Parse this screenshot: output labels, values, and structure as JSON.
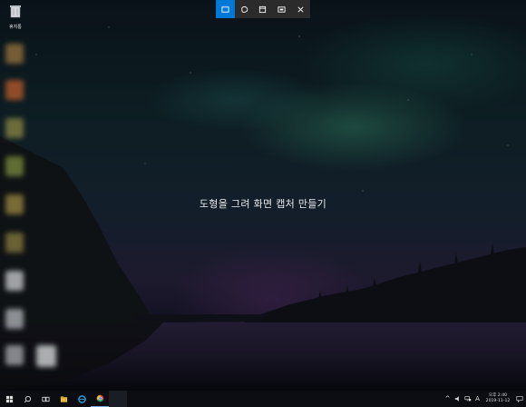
{
  "desktop": {
    "recycle_bin_label": "휴지통"
  },
  "snip_toolbar": {
    "modes": [
      {
        "name": "rectangle",
        "icon": "rectangle-snip-icon",
        "active": true
      },
      {
        "name": "freeform",
        "icon": "freeform-snip-icon",
        "active": false
      },
      {
        "name": "window",
        "icon": "window-snip-icon",
        "active": false
      },
      {
        "name": "fullscreen",
        "icon": "fullscreen-snip-icon",
        "active": false
      },
      {
        "name": "close",
        "icon": "close-icon",
        "active": false
      }
    ],
    "accent_color": "#0078d7"
  },
  "overlay": {
    "prompt": "도형을 그려 화면 캡처 만들기"
  },
  "taskbar": {
    "apps": [
      "windows-start-icon",
      "search-icon",
      "task-view-icon",
      "file-explorer-icon",
      "edge-icon",
      "chrome-icon"
    ],
    "tray": {
      "ime_indicator": "A",
      "time": "오후 2:40",
      "date": "2019-11-12"
    }
  }
}
